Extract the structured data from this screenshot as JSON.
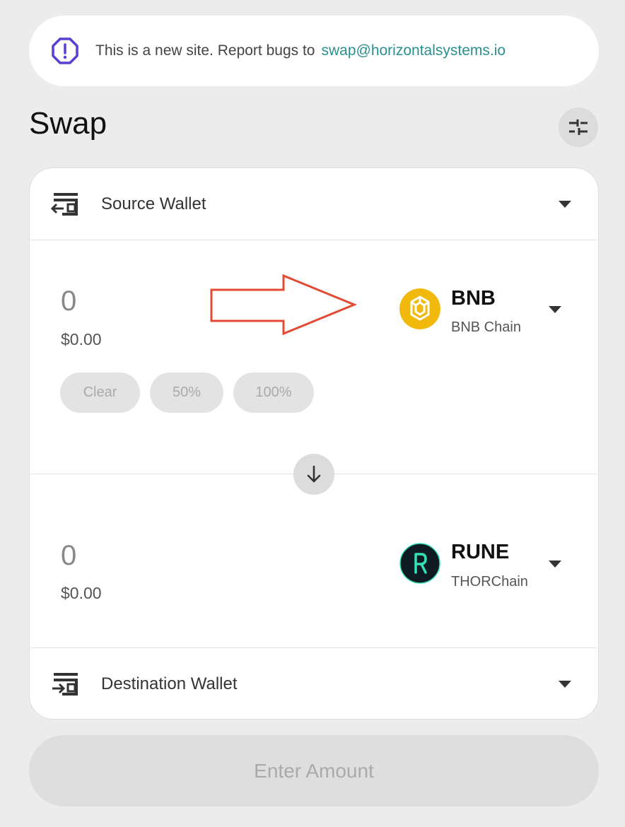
{
  "banner": {
    "message": "This is a new site. Report bugs to",
    "email": "swap@horizontalsystems.io"
  },
  "page": {
    "title": "Swap"
  },
  "source_wallet": {
    "label": "Source Wallet"
  },
  "from": {
    "amount": "0",
    "usd": "$0.00",
    "token_symbol": "BNB",
    "token_chain": "BNB Chain",
    "quick_buttons": [
      "Clear",
      "50%",
      "100%"
    ]
  },
  "to": {
    "amount": "0",
    "usd": "$0.00",
    "token_symbol": "RUNE",
    "token_chain": "THORChain"
  },
  "destination_wallet": {
    "label": "Destination Wallet"
  },
  "cta": {
    "label": "Enter Amount"
  },
  "colors": {
    "link": "#2a8f8f",
    "warning_icon": "#5a3fd6",
    "bnb": "#f0b90b",
    "rune_bg": "#0f1b22",
    "rune_accent": "#33e0b8",
    "annotation_arrow": "#e34a33"
  },
  "icons": [
    "warning-octagon-icon",
    "sliders-icon",
    "wallet-out-icon",
    "wallet-in-icon",
    "chevron-down-icon",
    "arrow-down-icon",
    "bnb-logo-icon",
    "rune-logo-icon"
  ]
}
